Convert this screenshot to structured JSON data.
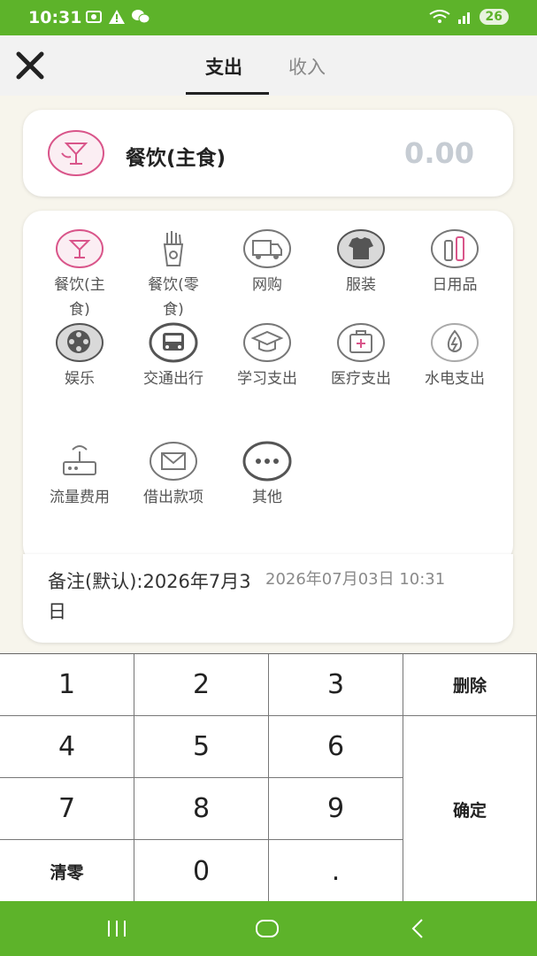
{
  "status_bar": {
    "time": "10:31",
    "battery": "26"
  },
  "header": {
    "close_icon": "close-icon",
    "tabs": [
      {
        "label": "支出",
        "active": true
      },
      {
        "label": "收入",
        "active": false
      }
    ]
  },
  "selected": {
    "icon": "dining-icon",
    "name": "餐饮(主食)",
    "amount": "0.00"
  },
  "categories": [
    {
      "label": "餐饮(主食)",
      "icon": "dining-icon"
    },
    {
      "label": "餐饮(零食)",
      "icon": "snack-icon"
    },
    {
      "label": "网购",
      "icon": "delivery-truck-icon"
    },
    {
      "label": "服装",
      "icon": "tshirt-icon"
    },
    {
      "label": "日用品",
      "icon": "toiletries-icon"
    },
    {
      "label": "娱乐",
      "icon": "film-reel-icon"
    },
    {
      "label": "交通出行",
      "icon": "bus-icon"
    },
    {
      "label": "学习支出",
      "icon": "graduation-cap-icon"
    },
    {
      "label": "医疗支出",
      "icon": "medical-kit-icon"
    },
    {
      "label": "水电支出",
      "icon": "utility-icon"
    },
    {
      "label": "流量费用",
      "icon": "router-icon"
    },
    {
      "label": "借出款项",
      "icon": "loan-envelope-icon"
    },
    {
      "label": "其他",
      "icon": "more-icon"
    }
  ],
  "note": {
    "text": "备注(默认):2026年7月3日",
    "date": "2026年07月03日 10:31"
  },
  "keypad": {
    "k1": "1",
    "k2": "2",
    "k3": "3",
    "delete": "删除",
    "k4": "4",
    "k5": "5",
    "k6": "6",
    "k7": "7",
    "k8": "8",
    "k9": "9",
    "confirm": "确定",
    "clear": "清零",
    "k0": "0",
    "dot": "."
  },
  "colors": {
    "brand": "#5db32a",
    "accent_pink": "#d9558a",
    "icon_gray": "#777777",
    "amount_placeholder": "#c6ccd3"
  }
}
